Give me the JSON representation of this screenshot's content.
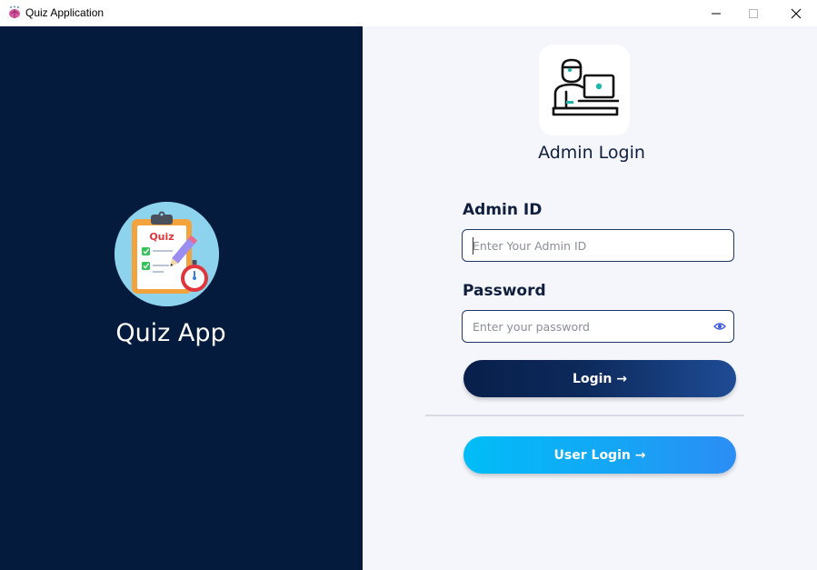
{
  "window": {
    "title": "Quiz Application",
    "controls": {
      "minimize": "minimize",
      "maximize": "maximize",
      "close": "close"
    }
  },
  "left_panel": {
    "logo_icon": "quiz-clipboard-icon",
    "logo_text": "Quiz",
    "app_name": "Quiz App",
    "background": "#051b3e"
  },
  "right_panel": {
    "avatar_icon": "admin-desk-icon",
    "title": "Admin Login",
    "admin_id": {
      "label": "Admin ID",
      "placeholder": "Enter Your Admin ID",
      "value": ""
    },
    "password": {
      "label": "Password",
      "placeholder": "Enter your password",
      "value": "",
      "toggle_icon": "eye-icon"
    },
    "login_button": "Login →",
    "user_login_button": "User Login →"
  },
  "colors": {
    "dark_navy": "#051b3e",
    "panel_bg": "#f4f6fc",
    "login_gradient_start": "#081f4a",
    "login_gradient_end": "#1f4c96",
    "user_gradient_start": "#00bdf7",
    "user_gradient_end": "#2c8df5",
    "eye_icon": "#3b5bd9"
  }
}
